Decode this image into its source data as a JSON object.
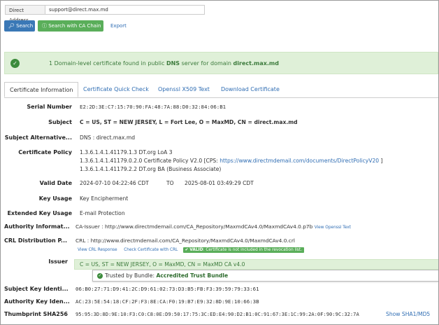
{
  "search": {
    "label": "Direct Address",
    "value": "support@direct.max.md",
    "search_btn": "Search",
    "ca_btn": "Search with CA Chain",
    "export": "Export"
  },
  "alert": {
    "prefix": "1 Domain-level certificate found in public ",
    "dns": "DNS",
    "mid": " server for domain ",
    "domain": "direct.max.md"
  },
  "tabs": [
    "Certificate Information",
    "Certificate Quick Check",
    "Openssl X509 Text",
    "Download Certificate"
  ],
  "cert": {
    "serial": {
      "label": "Serial Number",
      "value": "E2:2D:3E:C7:15:70:90:FA:48:7A:88:D0:32:84:06:B1"
    },
    "subject": {
      "label": "Subject",
      "value": "C = US, ST = NEW JERSEY, L = Fort Lee, O = MaxMD, CN = direct.max.md"
    },
    "san": {
      "label": "Subject Alternative...",
      "value": "DNS : direct.max.md"
    },
    "policy": {
      "label": "Certificate Policy",
      "line1": "1.3.6.1.4.1.41179.1.3  DT.org LoA 3",
      "line2_prefix": "1.3.6.1.4.1.41179.0.2.0  Certificate Policy V2.0  [CPS: ",
      "line2_link": "https://www.directmdemail.com/documents/DirectPolicyV20",
      "line2_suffix": " ]",
      "line3": "1.3.6.1.4.1.41179.2.2  DT.org BA (Business Associate)"
    },
    "valid": {
      "label": "Valid Date",
      "from": "2024-07-10 04:22:46 CDT",
      "to_word": "TO",
      "to": "2025-08-01 03:49:29 CDT"
    },
    "key_usage": {
      "label": "Key Usage",
      "value": "Key Encipherment"
    },
    "ext_key_usage": {
      "label": "Extended Key Usage",
      "value": "E-mail Protection"
    },
    "aia": {
      "label": "Authority Informat...",
      "value": "CA-Issuer : http://www.directmdemail.com/CA_Repository/MaxmdCAv4.0/MaxmdCAv4.0.p7b",
      "link": "View Openssl Text"
    },
    "crl": {
      "label": "CRL Distribution P...",
      "value": "CRL : http://www.directmdemail.com/CA_Repository/MaxmdCAv4.0/MaxmdCAv4.0.crl",
      "link1": "View CRL Response",
      "link2": "Check Certificate with CRL",
      "valid_badge": "VALID",
      "valid_text": ": Certificate is not included in the revocation list."
    },
    "issuer": {
      "label": "Issuer",
      "value": "C = US, ST = NEW JERSEY, O = MaxMD, CN = MaxMD CA v4.0",
      "trust_prefix": "Trusted by Bundle: ",
      "trust_bundle": "Accredited Trust Bundle"
    },
    "ski": {
      "label": "Subject Key Identi...",
      "value": "06:B0:27:71:D9:41:2C:D9:61:02:73:D3:B5:FB:F3:39:59:79:33:61"
    },
    "aki": {
      "label": "Authority Key Iden...",
      "value": "AC:23:5E:54:18:CF:2F:F3:8E:CA:F0:19:B7:E9:32:8D:9E:10:66:3B"
    },
    "thumb": {
      "label": "Thumbprint SHA256",
      "value": "95:95:3D:8D:9E:10:F3:C0:C8:0E:D9:50:17:75:3C:ED:E4:90:D2:B1:0C:91:67:3E:1C:99:2A:0F:90:9C:32:7A",
      "link": "Show SHA1/MD5"
    }
  }
}
